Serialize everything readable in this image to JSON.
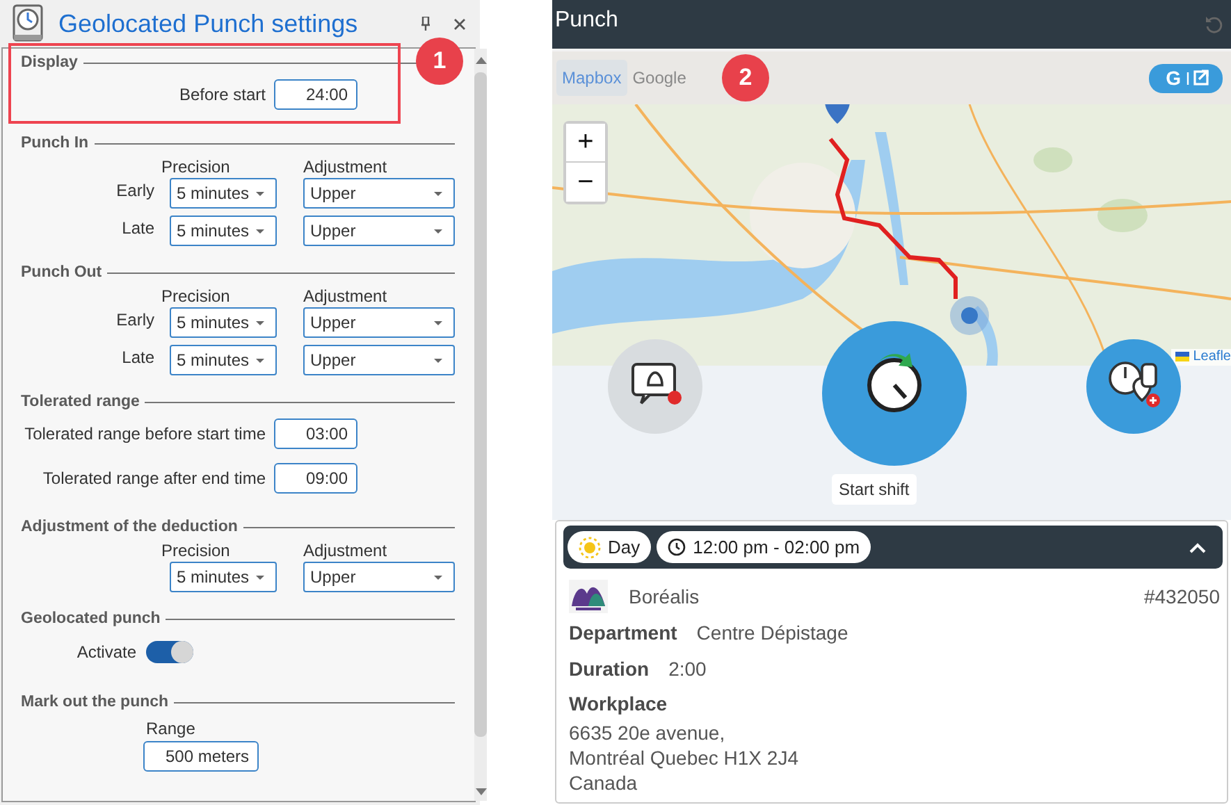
{
  "settings_window": {
    "title": "Geolocated Punch settings"
  },
  "sections": [
    {
      "kind": "fields",
      "title": "Display",
      "highlighted": true,
      "callout": "1",
      "rows": [
        {
          "label": "Before start",
          "value": "24:00"
        }
      ]
    },
    {
      "kind": "grid",
      "title": "Punch In",
      "column_labels": [
        "Precision",
        "Adjustment"
      ],
      "rows": [
        {
          "label": "Early",
          "precision": "5 minutes",
          "adjustment": "Upper"
        },
        {
          "label": "Late",
          "precision": "5 minutes",
          "adjustment": "Upper"
        }
      ]
    },
    {
      "kind": "grid",
      "title": "Punch Out",
      "column_labels": [
        "Precision",
        "Adjustment"
      ],
      "rows": [
        {
          "label": "Early",
          "precision": "5 minutes",
          "adjustment": "Upper"
        },
        {
          "label": "Late",
          "precision": "5 minutes",
          "adjustment": "Upper"
        }
      ]
    },
    {
      "kind": "fields",
      "title": "Tolerated range",
      "highlighted": false,
      "rows": [
        {
          "label": "Tolerated range before start time",
          "value": "03:00"
        },
        {
          "label": "Tolerated range after end time",
          "value": "09:00"
        }
      ]
    },
    {
      "kind": "grid",
      "title": "Adjustment of the deduction",
      "column_labels": [
        "Precision",
        "Adjustment"
      ],
      "rows": [
        {
          "precision": "5 minutes",
          "adjustment": "Upper"
        }
      ]
    },
    {
      "kind": "toggle",
      "title": "Geolocated punch",
      "label": "Activate",
      "on": true
    },
    {
      "kind": "range",
      "title": "Mark out the punch",
      "label": "Range",
      "value": "500 meters"
    }
  ],
  "punch": {
    "title": "Punch",
    "map_tabs": [
      {
        "label": "Mapbox",
        "selected": true
      },
      {
        "label": "Google",
        "selected": false
      }
    ],
    "callout": "2",
    "google_button": "G",
    "zoom_in": "+",
    "zoom_out": "−",
    "attribution": "Leafle",
    "action_label": "Start shift",
    "shift": {
      "period": "Day",
      "time": "12:00 pm - 02:00 pm",
      "expanded": true
    },
    "employer": "Boréalis",
    "number": "#432050",
    "details": [
      {
        "label": "Department",
        "value": "Centre Dépistage"
      },
      {
        "label": "Duration",
        "value": "2:00"
      }
    ],
    "workplace": {
      "label": "Workplace",
      "lines": [
        "6635 20e avenue,",
        "Montréal Quebec H1X 2J4",
        "Canada"
      ]
    }
  }
}
